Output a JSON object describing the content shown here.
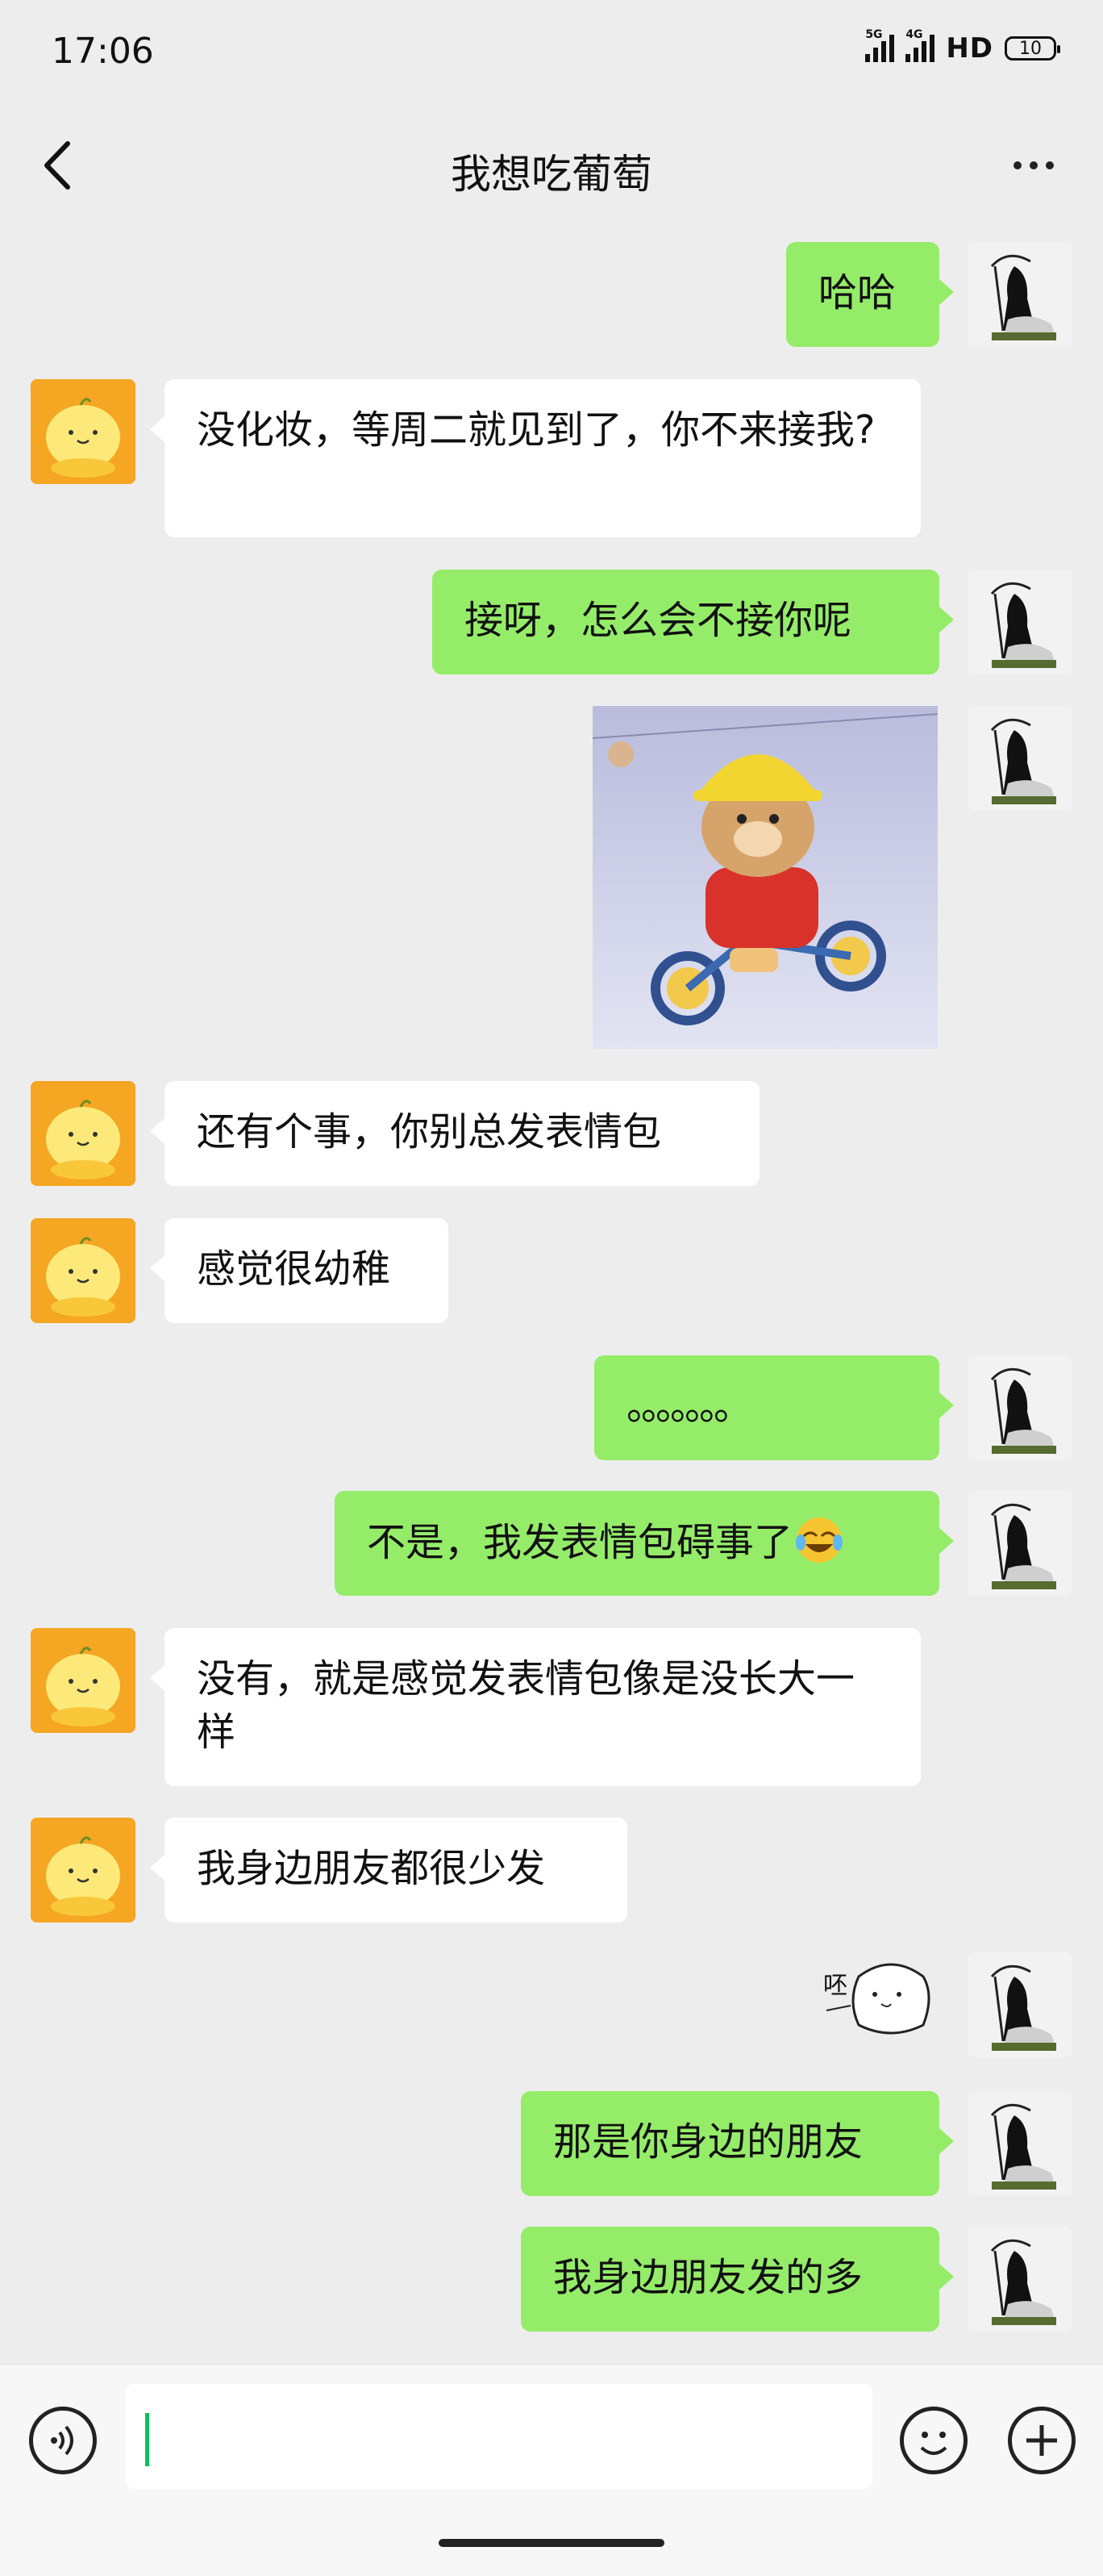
{
  "status": {
    "time": "17:06",
    "network1": "5G",
    "network2": "4G",
    "hd": "HD",
    "battery": "10"
  },
  "nav": {
    "title": "我想吃葡萄"
  },
  "messages": [
    {
      "side": "out",
      "type": "text",
      "text": "哈哈"
    },
    {
      "side": "in",
      "type": "text",
      "text": "没化妆，等周二就见到了，你不来接我?"
    },
    {
      "side": "out",
      "type": "text",
      "text": "接呀，怎么会不接你呢"
    },
    {
      "side": "out",
      "type": "sticker",
      "sticker": "bear-on-tricycle"
    },
    {
      "side": "in",
      "type": "text",
      "text": "还有个事，你别总发表情包"
    },
    {
      "side": "in",
      "type": "text",
      "text": "感觉很幼稚"
    },
    {
      "side": "out",
      "type": "text",
      "text": "。。。。。。。"
    },
    {
      "side": "out",
      "type": "text",
      "text": "不是，我发表情包碍事了"
    },
    {
      "side": "in",
      "type": "text",
      "text": "没有，就是感觉发表情包像是没长大一样"
    },
    {
      "side": "in",
      "type": "text",
      "text": "我身边朋友都很少发"
    },
    {
      "side": "out",
      "type": "sticker",
      "sticker": "bear-spit",
      "caption": "呸"
    },
    {
      "side": "out",
      "type": "text",
      "text": "那是你身边的朋友"
    },
    {
      "side": "out",
      "type": "text",
      "text": "我身边朋友发的多"
    }
  ],
  "input": {
    "value": ""
  }
}
